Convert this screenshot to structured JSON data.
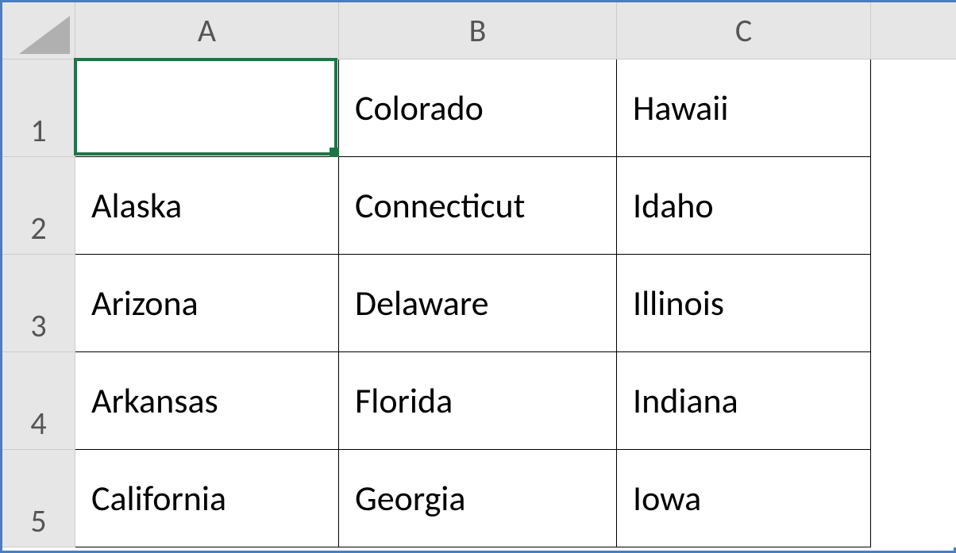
{
  "columns": [
    "A",
    "B",
    "C"
  ],
  "rows": [
    "1",
    "2",
    "3",
    "4",
    "5"
  ],
  "selectedCell": "A1",
  "cells": {
    "A1": "",
    "B1": "Colorado",
    "C1": "Hawaii",
    "A2": "Alaska",
    "B2": "Connecticut",
    "C2": "Idaho",
    "A3": "Arizona",
    "B3": "Delaware",
    "C3": "Illinois",
    "A4": "Arkansas",
    "B4": "Florida",
    "C4": "Indiana",
    "A5": "California",
    "B5": "Georgia",
    "C5": "Iowa"
  }
}
